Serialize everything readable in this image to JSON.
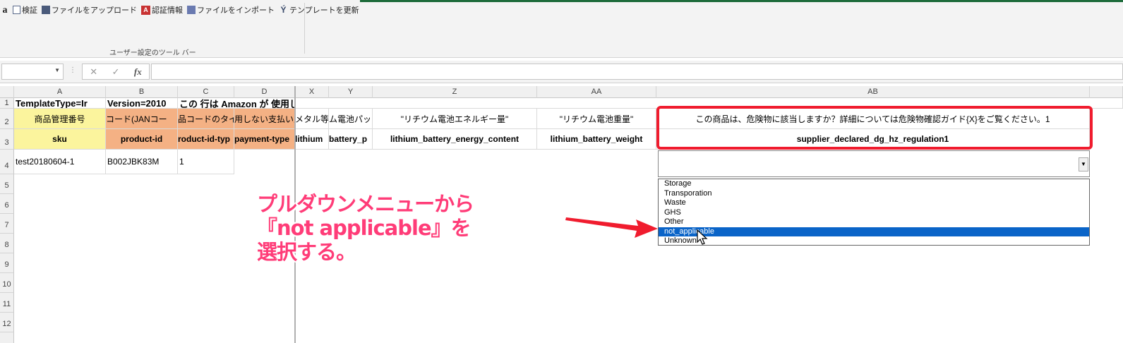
{
  "toolbar": {
    "items": [
      {
        "icon": "amazon-icon",
        "glyph": "a",
        "label": ""
      },
      {
        "icon": "validate-icon",
        "glyph": "",
        "label": "検証"
      },
      {
        "icon": "upload-icon",
        "glyph": "",
        "label": "ファイルをアップロード"
      },
      {
        "icon": "auth-icon",
        "glyph": "A",
        "label": "認証情報"
      },
      {
        "icon": "import-icon",
        "glyph": "",
        "label": "ファイルをインポート"
      },
      {
        "icon": "template-icon",
        "glyph": "Ý",
        "label": "テンプレートを更新"
      }
    ],
    "group_label": "ユーザー設定のツール バー"
  },
  "formula_bar": {
    "name_box": "",
    "cancel": "✕",
    "enter": "✓",
    "fx": "fx",
    "content": ""
  },
  "columns": [
    "A",
    "B",
    "C",
    "D",
    "X",
    "Y",
    "Z",
    "AA",
    "AB"
  ],
  "rows": [
    "1",
    "2",
    "3",
    "4",
    "5",
    "6",
    "7",
    "8",
    "9",
    "10",
    "11",
    "12"
  ],
  "cells": {
    "r1": {
      "a": "TemplateType=Ir",
      "b": "Version=2010",
      "c": "この 行は Amazon が 使用しま"
    },
    "r2": {
      "a": "商品管理番号",
      "b": "コード(JANコー",
      "c": "品コードのタイ",
      "d": "用しない支払い入",
      "x": "メタル等",
      "y": "ム電池パッ",
      "z": "\"リチウム電池エネルギー量\"",
      "aa": "\"リチウム電池重量\"",
      "ab": "この商品は、危険物に該当しますか？詳細については危険物確認ガイド{X}をご覧ください。1"
    },
    "r3": {
      "a": "sku",
      "b": "product-id",
      "c": "roduct-id-typ",
      "d": "payment-type",
      "x": "lithium",
      "y": "battery_p",
      "z": "lithium_battery_energy_content",
      "aa": "lithium_battery_weight",
      "ab": "supplier_declared_dg_hz_regulation1"
    },
    "r4": {
      "a": "test20180604-1",
      "b": "B002JBK83M",
      "c": "1"
    }
  },
  "dropdown": {
    "options": [
      "Storage",
      "Transporation",
      "Waste",
      "GHS",
      "Other",
      "not_applicable",
      "Unknown"
    ],
    "selected_index": 5
  },
  "annotation": {
    "line1": "プルダウンメニューから",
    "line2": "『not applicable』を",
    "line3": "選択する。"
  },
  "colors": {
    "highlight": "#f01c2e",
    "annotation_text": "#ff3c78",
    "header_yellow": "#fbf49d",
    "header_orange": "#f4b184",
    "selected_option": "#0a64c8"
  }
}
